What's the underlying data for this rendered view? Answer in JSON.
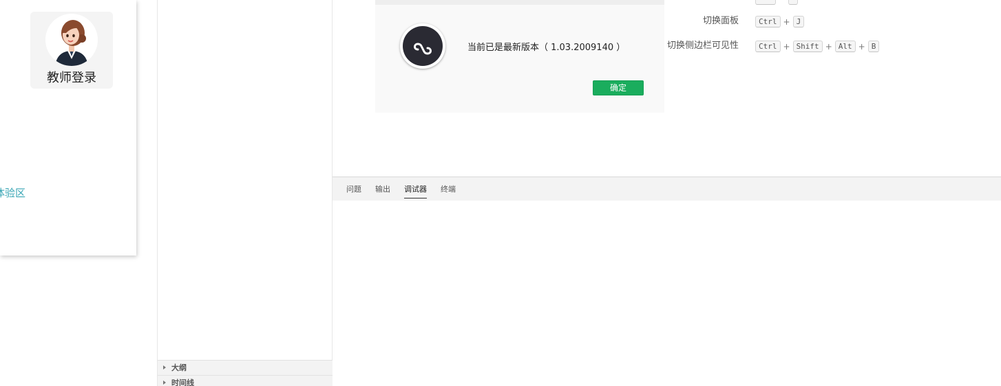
{
  "simulator": {
    "login_label": "教师登录",
    "experience_link": "体验区"
  },
  "explorer": {
    "sections": [
      {
        "label": "大纲"
      },
      {
        "label": "时间线"
      }
    ]
  },
  "dialog": {
    "version_text": "当前已是最新版本（ 1.03.2009140 ）",
    "ok_label": "确定"
  },
  "shortcuts": {
    "rows": [
      {
        "label": "切换面板",
        "keys": [
          "Ctrl",
          "J"
        ]
      },
      {
        "label": "切换侧边栏可见性",
        "keys": [
          "Ctrl",
          "Shift",
          "Alt",
          "B"
        ]
      }
    ],
    "plus": "+"
  },
  "panel": {
    "tabs": [
      {
        "label": "问题",
        "active": false
      },
      {
        "label": "输出",
        "active": false
      },
      {
        "label": "调试器",
        "active": true
      },
      {
        "label": "终端",
        "active": false
      }
    ]
  },
  "colors": {
    "accent_green": "#1aad5d",
    "link_teal": "#3aa6b5"
  }
}
